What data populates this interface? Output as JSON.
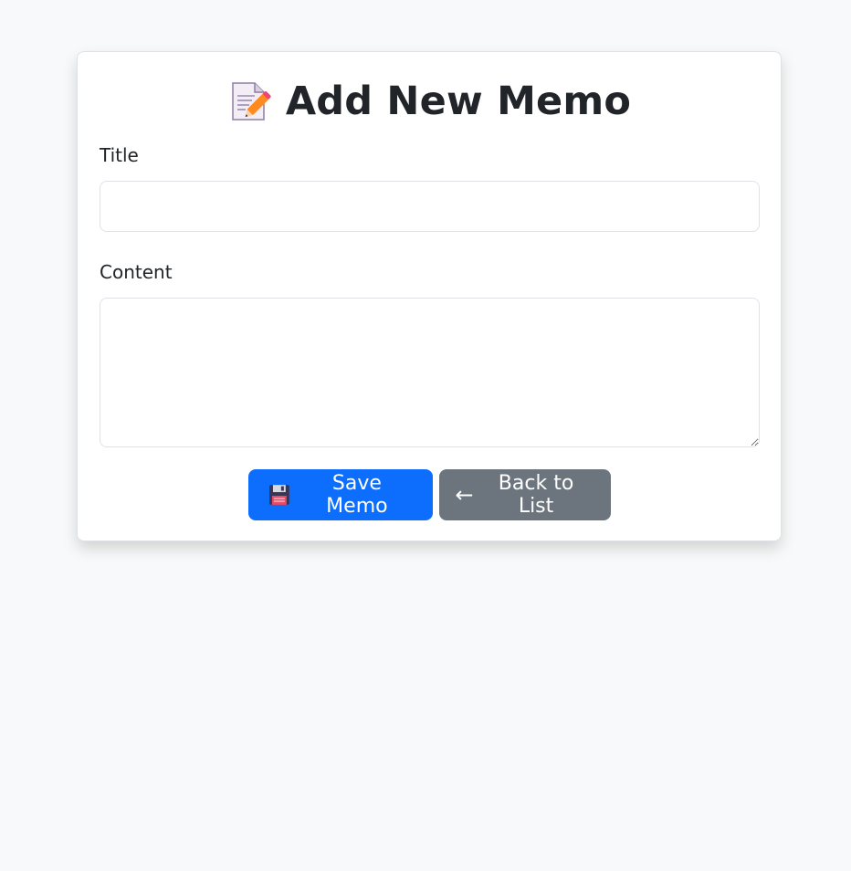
{
  "header": {
    "title": "Add New Memo",
    "icon": "memo-pencil-icon"
  },
  "form": {
    "title_label": "Title",
    "title_value": "",
    "content_label": "Content",
    "content_value": ""
  },
  "actions": {
    "save_label": "Save Memo",
    "save_icon": "floppy-disk-icon",
    "back_arrow": "←",
    "back_label": "Back to List"
  },
  "colors": {
    "primary": "#0d6efd",
    "secondary": "#6c757d",
    "background": "#f8f9fa"
  }
}
